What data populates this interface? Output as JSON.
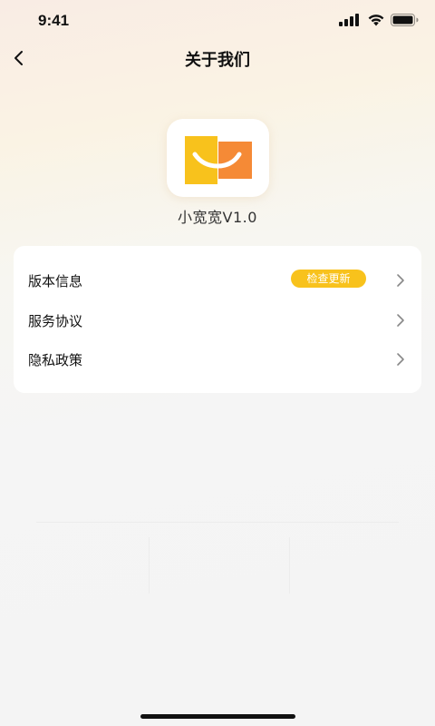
{
  "status_bar": {
    "time": "9:41"
  },
  "nav": {
    "title": "关于我们"
  },
  "app": {
    "name": "小宽宽V1.0",
    "logo_colors": {
      "yellow": "#f8c21c",
      "orange": "#f58a36"
    }
  },
  "menu": {
    "items": [
      {
        "label": "版本信息",
        "badge": "检查更新"
      },
      {
        "label": "服务协议"
      },
      {
        "label": "隐私政策"
      }
    ]
  },
  "colors": {
    "accent": "#f8c21c",
    "background": "#f5f5f5",
    "card": "#ffffff"
  }
}
